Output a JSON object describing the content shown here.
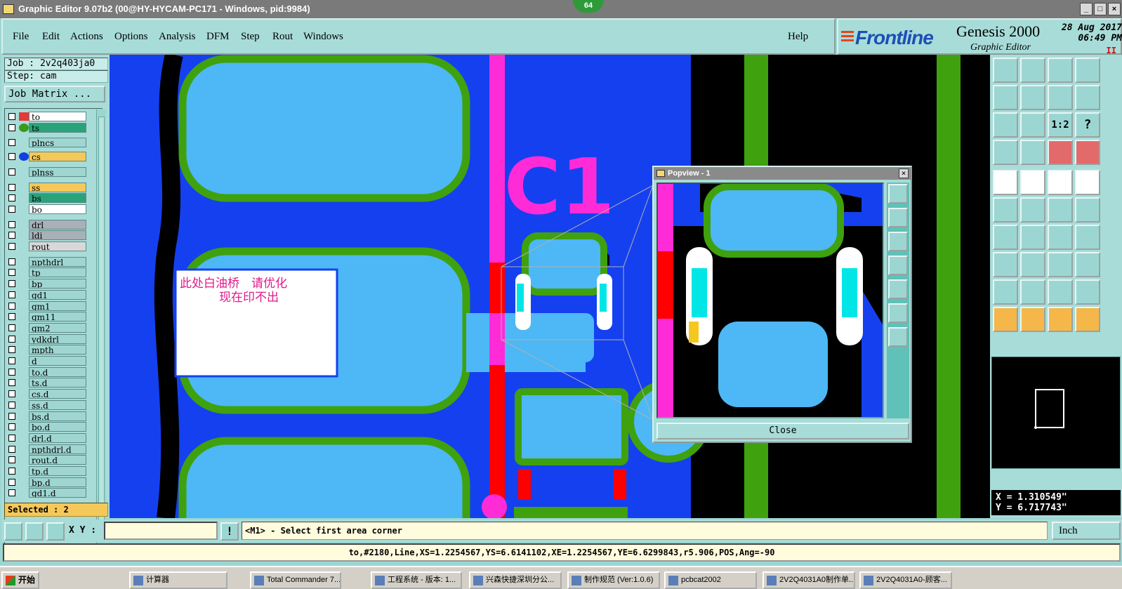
{
  "window": {
    "title": "Graphic Editor 9.07b2 (00@HY-HYCAM-PC171 - Windows, pid:9984)",
    "badge": "64",
    "min_glyph": "_",
    "max_glyph": "□",
    "close_glyph": "×"
  },
  "menu": {
    "items": [
      "File",
      "Edit",
      "Actions",
      "Options",
      "Analysis",
      "DFM",
      "Step",
      "Rout",
      "Windows"
    ],
    "help": "Help"
  },
  "brand": {
    "logo": "Frontline",
    "product": "Genesis 2000",
    "subtitle": "Graphic Editor",
    "date": "28 Aug 2017",
    "time": "06:49 PM",
    "pause_glyph": "II"
  },
  "left": {
    "job": "Job : 2v2q403ja0",
    "step": "Step: cam",
    "job_matrix": "Job Matrix ...",
    "selected": "Selected : 2",
    "layers": [
      {
        "name": "to",
        "color": "#ffffff",
        "swatch": "#e33a3a"
      },
      {
        "name": "ts",
        "color": "#2aa37a",
        "swatch": "#3a9a1a"
      },
      {
        "name": "plncs",
        "color": "#9fd6d2",
        "swatch": ""
      },
      {
        "name": "cs",
        "color": "#f5c85a",
        "swatch": "#1040e0"
      },
      {
        "name": "plnss",
        "color": "#9fd6d2",
        "swatch": ""
      },
      {
        "name": "ss",
        "color": "#f5c85a",
        "swatch": ""
      },
      {
        "name": "bs",
        "color": "#2aa37a",
        "swatch": ""
      },
      {
        "name": "bo",
        "color": "#ffffff",
        "swatch": ""
      },
      {
        "name": "drl",
        "color": "#a8b0b8",
        "swatch": ""
      },
      {
        "name": "ldi",
        "color": "#a8b0b8",
        "swatch": ""
      },
      {
        "name": "rout",
        "color": "#d8d8d8",
        "swatch": ""
      },
      {
        "name": "npthdrl",
        "color": "#9fd6d2",
        "swatch": ""
      },
      {
        "name": "tp",
        "color": "#9fd6d2",
        "swatch": ""
      },
      {
        "name": "bp",
        "color": "#9fd6d2",
        "swatch": ""
      },
      {
        "name": "gd1",
        "color": "#9fd6d2",
        "swatch": ""
      },
      {
        "name": "gm1",
        "color": "#9fd6d2",
        "swatch": ""
      },
      {
        "name": "gm11",
        "color": "#9fd6d2",
        "swatch": ""
      },
      {
        "name": "gm2",
        "color": "#9fd6d2",
        "swatch": ""
      },
      {
        "name": "ydkdrl",
        "color": "#9fd6d2",
        "swatch": ""
      },
      {
        "name": "mpth",
        "color": "#9fd6d2",
        "swatch": ""
      },
      {
        "name": "d",
        "color": "#9fd6d2",
        "swatch": ""
      },
      {
        "name": "to.d",
        "color": "#9fd6d2",
        "swatch": ""
      },
      {
        "name": "ts.d",
        "color": "#9fd6d2",
        "swatch": ""
      },
      {
        "name": "cs.d",
        "color": "#9fd6d2",
        "swatch": ""
      },
      {
        "name": "ss.d",
        "color": "#9fd6d2",
        "swatch": ""
      },
      {
        "name": "bs.d",
        "color": "#9fd6d2",
        "swatch": ""
      },
      {
        "name": "bo.d",
        "color": "#9fd6d2",
        "swatch": ""
      },
      {
        "name": "drl.d",
        "color": "#9fd6d2",
        "swatch": ""
      },
      {
        "name": "npthdrl.d",
        "color": "#9fd6d2",
        "swatch": ""
      },
      {
        "name": "rout.d",
        "color": "#9fd6d2",
        "swatch": ""
      },
      {
        "name": "tp.d",
        "color": "#9fd6d2",
        "swatch": ""
      },
      {
        "name": "bp.d",
        "color": "#9fd6d2",
        "swatch": ""
      },
      {
        "name": "gd1.d",
        "color": "#9fd6d2",
        "swatch": ""
      }
    ]
  },
  "canvas": {
    "silk_label": "C1",
    "note_line1": "此处白油桥　请优化",
    "note_line2": "现在印不出"
  },
  "popup": {
    "title": "Popview - 1",
    "close_label": "Close",
    "close_glyph": "×"
  },
  "right": {
    "ratio_label": "1:2",
    "help_glyph": "?",
    "x": "X = 1.310549\"",
    "y": "Y = 6.717743\""
  },
  "bottom": {
    "xy_label": "X Y :",
    "xy_value": "",
    "bang_glyph": "!",
    "prompt": "<M1> - Select first area corner",
    "unit": "Inch",
    "status": "to,#2180,Line,XS=1.2254567,YS=6.6141102,XE=1.2254567,YE=6.6299843,r5.906,POS,Ang=-90"
  },
  "taskbar": {
    "start": "开始",
    "tasks": [
      "计算器",
      "Total Commander 7...",
      "工程系统 - 版本: 1...",
      "兴森快捷深圳分公...",
      "制作规范 (Ver:1.0.6)",
      "pcbcat2002",
      "2V2Q4031A0制作单...",
      "2V2Q4031A0-顾客..."
    ]
  },
  "colors": {
    "panel": "#a8dcd8",
    "canvas_bg": "#000000",
    "pad": "#4db8f5",
    "blue_copper": "#1540f0",
    "green_mask": "#3fa10e",
    "magenta": "#ff2bd7",
    "red": "#ff0000"
  }
}
